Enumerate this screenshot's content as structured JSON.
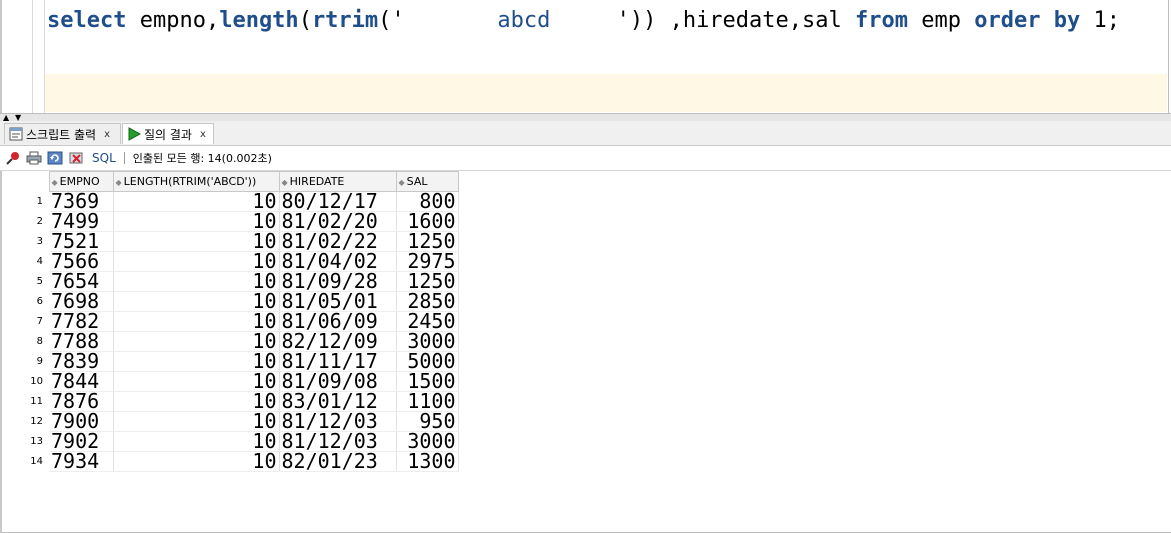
{
  "editor": {
    "tokens": [
      {
        "text": "select",
        "style": "kw"
      },
      {
        "text": " empno,",
        "style": "plain"
      },
      {
        "text": "length",
        "style": "kw"
      },
      {
        "text": "(",
        "style": "plain"
      },
      {
        "text": "rtrim",
        "style": "kw"
      },
      {
        "text": "('",
        "style": "plain"
      },
      {
        "text": "       abcd     ",
        "style": "str"
      },
      {
        "text": "')) ,hiredate,sal ",
        "style": "plain"
      },
      {
        "text": "from",
        "style": "kw"
      },
      {
        "text": " emp ",
        "style": "plain"
      },
      {
        "text": "order by",
        "style": "kw"
      },
      {
        "text": " 1;",
        "style": "plain"
      }
    ]
  },
  "tabs": [
    {
      "label": "스크립트 출력",
      "close": "x",
      "icon": "script-output-icon",
      "active": false
    },
    {
      "label": "질의 결과",
      "close": "x",
      "icon": "run-query-icon",
      "active": true
    }
  ],
  "toolbar": {
    "sql_label": "SQL",
    "status": "인출된 모든 행: 14(0.002초)",
    "icons": [
      "pin-icon",
      "print-icon",
      "refresh-icon",
      "close-red-icon"
    ]
  },
  "grid": {
    "columns": [
      "EMPNO",
      "LENGTH(RTRIM('ABCD'))",
      "HIREDATE",
      "SAL"
    ],
    "rows": [
      [
        "1",
        "7369",
        "10",
        "80/12/17",
        "800"
      ],
      [
        "2",
        "7499",
        "10",
        "81/02/20",
        "1600"
      ],
      [
        "3",
        "7521",
        "10",
        "81/02/22",
        "1250"
      ],
      [
        "4",
        "7566",
        "10",
        "81/04/02",
        "2975"
      ],
      [
        "5",
        "7654",
        "10",
        "81/09/28",
        "1250"
      ],
      [
        "6",
        "7698",
        "10",
        "81/05/01",
        "2850"
      ],
      [
        "7",
        "7782",
        "10",
        "81/06/09",
        "2450"
      ],
      [
        "8",
        "7788",
        "10",
        "82/12/09",
        "3000"
      ],
      [
        "9",
        "7839",
        "10",
        "81/11/17",
        "5000"
      ],
      [
        "10",
        "7844",
        "10",
        "81/09/08",
        "1500"
      ],
      [
        "11",
        "7876",
        "10",
        "83/01/12",
        "1100"
      ],
      [
        "12",
        "7900",
        "10",
        "81/12/03",
        "950"
      ],
      [
        "13",
        "7902",
        "10",
        "81/12/03",
        "3000"
      ],
      [
        "14",
        "7934",
        "10",
        "82/01/23",
        "1300"
      ]
    ]
  },
  "colors": {
    "keyword": "#1f4e8c",
    "current_line": "#fff8e5",
    "header_bg": "#f3f3f3"
  }
}
